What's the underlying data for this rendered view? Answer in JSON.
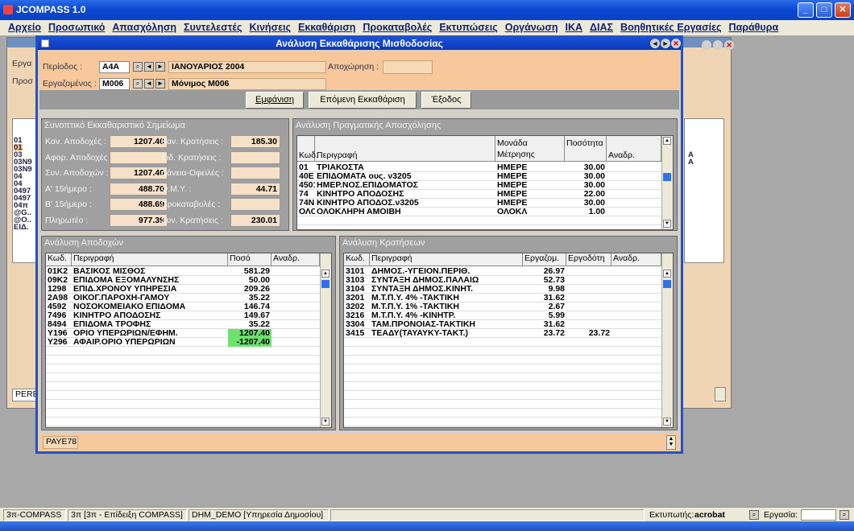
{
  "app_title": "JCOMPASS 1.0",
  "menu": [
    "Αρχείο",
    "Προσωπικό",
    "Απασχόληση",
    "Συντελεστές",
    "Κινήσεις",
    "Εκκαθάριση",
    "Προκαταβολές",
    "Εκτυπώσεις",
    "Οργάνωση",
    "IKA",
    "ΔΙΑΣ",
    "Βοηθητικές Εργασίες",
    "Παράθυρα"
  ],
  "bg": {
    "lbl1": "Εργα",
    "lbl2": "Προσ",
    "codes": [
      "01",
      "01",
      "03",
      "03N9",
      "03N9",
      "04",
      "04",
      "0497",
      "0497",
      "04π",
      "@G..",
      "@O..",
      "ΕΙΔ."
    ],
    "flags": [
      "A",
      "A"
    ],
    "pere": "PERE"
  },
  "window": {
    "title": "Ανάλυση Εκκαθάρισης Μισθοδοσίας"
  },
  "form": {
    "period_label": "Περίοδος :",
    "period_code": "A4A",
    "period_desc": "ΙΑΝΟΥΑΡΙΟΣ 2004",
    "employee_label": "Εργαζομένος :",
    "employee_code": "M006",
    "employee_desc": "Μόνιμος Μ006",
    "leave_label": "Αποχώρηση :"
  },
  "buttons": {
    "show": "Εμφάνιση",
    "next": "Επόμενη Εκκαθάριση",
    "exit": "Έξοδος"
  },
  "summary": {
    "title": "Συνοπτικό Εκκαθαριστικό Σημείωμα",
    "left": [
      {
        "label": "Καν. Αποδοχές :",
        "value": "1207.40"
      },
      {
        "label": "Αφορ. Αποδοχές :",
        "value": ""
      },
      {
        "label": "Συν. Αποδοχών :",
        "value": "1207.40"
      },
      {
        "label": "Α' 15ήμερο :",
        "value": "488.70"
      },
      {
        "label": "Β' 15ήμερο :",
        "value": "488.69"
      },
      {
        "label": "Πληρωτέο :",
        "value": "977.39"
      }
    ],
    "right": [
      {
        "label": "Καν. Κρατήσεις :",
        "value": "185.30"
      },
      {
        "label": "Ειδ. Κρατήσεις :",
        "value": ""
      },
      {
        "label": "Δάνεια-Οφειλές :",
        "value": ""
      },
      {
        "label": "Φ.Μ.Υ. :",
        "value": "44.71"
      },
      {
        "label": "Προκαταβολές :",
        "value": ""
      },
      {
        "label": "Συν. Κρατήσεις :",
        "value": "230.01"
      }
    ]
  },
  "employment": {
    "title": "Ανάλυση Πραγματικής Απασχόλησης",
    "headers": [
      "Κωδ.",
      "Περιγραφή",
      "Μονάδα Μέτρησης",
      "Ποσότητα",
      "Αναδρ."
    ],
    "rows": [
      [
        "01",
        "ΤΡΙΑΚΟΣΤΑ",
        "ΗΜΕΡΕ",
        "30.00",
        ""
      ],
      [
        "40E",
        "ΕΠΙΔΟΜΑΤΑ ους. ν3205",
        "ΗΜΕΡΕ",
        "30.00",
        ""
      ],
      [
        "4501",
        "ΗΜΕΡ.ΝΟΣ.ΕΠΙΔΟΜΑΤΟΣ",
        "ΗΜΕΡΕ",
        "30.00",
        ""
      ],
      [
        "74",
        "ΚΙΝΗΤΡΟ ΑΠΟΔΟΣΗΣ",
        "ΗΜΕΡΕ",
        "22.00",
        ""
      ],
      [
        "74N",
        "ΚΙΝΗΤΡΟ ΑΠΟΔΟΣ.ν3205",
        "ΗΜΕΡΕ",
        "30.00",
        ""
      ],
      [
        "ΟΛΟΚ",
        "ΟΛΟΚΛΗΡΗ ΑΜΟΙΒΗ",
        "ΟΛΟΚΛ",
        "1.00",
        ""
      ]
    ]
  },
  "earnings": {
    "title": "Ανάλυση Αποδοχών",
    "headers": [
      "Κωδ.",
      "Περιγραφή",
      "Ποσό",
      "Αναδρ."
    ],
    "rows": [
      [
        "01K2",
        "ΒΑΣΙΚΟΣ ΜΙΣΘΟΣ",
        "581.29",
        ""
      ],
      [
        "09K2",
        "ΕΠΙΔΟΜΑ ΕΞΟΜΑΛΥΝΣΗΣ",
        "50.00",
        ""
      ],
      [
        "1298",
        "ΕΠΙΔ.ΧΡΟΝΟΥ ΥΠΗΡΕΣΙΑ",
        "209.26",
        ""
      ],
      [
        "2A98",
        "ΟΙΚΟΓ.ΠΑΡΟΧΗ-ΓΑΜΟΥ",
        "35.22",
        ""
      ],
      [
        "4592",
        "ΝΟΣΟΚΟΜΕΙΑΚΟ ΕΠΙΔΟΜΑ",
        "146.74",
        ""
      ],
      [
        "7496",
        "ΚΙΝΗΤΡΟ ΑΠΟΔΟΣΗΣ",
        "149.67",
        ""
      ],
      [
        "8494",
        "ΕΠΙΔΟΜΑ ΤΡΟΦΗΣ",
        "35.22",
        ""
      ],
      [
        "Y196",
        "ΟΡΙΟ ΥΠΕΡΩΡΙΩΝ/ΕΦΗΜ.",
        "1207.40",
        ""
      ],
      [
        "Y296",
        "ΑΦΑΙΡ.ΟΡΙΟ ΥΠΕΡΩΡΙΩΝ",
        "-1207.40",
        ""
      ]
    ]
  },
  "deductions": {
    "title": "Ανάλυση Κρατήσεων",
    "headers": [
      "Κωδ.",
      "Περιγραφή",
      "Εργαζομ.",
      "Εργοδότη",
      "Αναδρ."
    ],
    "rows": [
      [
        "3101",
        "ΔΗΜΟΣ.-ΥΓΕΙΟΝ.ΠΕΡΙΘ.",
        "26.97",
        "",
        ""
      ],
      [
        "3103",
        "ΣΥΝΤΑΞΗ ΔΗΜΟΣ.ΠΑΛΑΙΩ",
        "52.73",
        "",
        ""
      ],
      [
        "3104",
        "ΣΥΝΤΑΞΗ ΔΗΜΟΣ.ΚΙΝΗΤ.",
        "9.98",
        "",
        ""
      ],
      [
        "3201",
        "Μ.Τ.Π.Υ. 4% -ΤΑΚΤΙΚΗ",
        "31.62",
        "",
        ""
      ],
      [
        "3202",
        "Μ.Τ.Π.Υ. 1% -ΤΑΚΤΙΚΗ",
        "2.67",
        "",
        ""
      ],
      [
        "3216",
        "Μ.Τ.Π.Υ. 4% -ΚΙΝΗΤΡ.",
        "5.99",
        "",
        ""
      ],
      [
        "3304",
        "ΤΑΜ.ΠΡΟΝΟΙΑΣ-ΤΑΚΤΙΚΗ",
        "31.62",
        "",
        ""
      ],
      [
        "3415",
        "ΤΕΑΔΥ(ΤΑΥΑΥΚΥ-ΤΑΚΤ.)",
        "23.72",
        "23.72",
        ""
      ]
    ]
  },
  "form_status": "PAYE78",
  "status": {
    "c1": "3π-COMPASS",
    "c2": "3π [3π - Επίδειξη COMPASS]",
    "c3": "DHM_DEMO [Υπηρεσία Δημοσίου]",
    "printer_label": "Εκτυπωτής:",
    "printer": "acrobat",
    "task_label": "Εργασία:"
  }
}
